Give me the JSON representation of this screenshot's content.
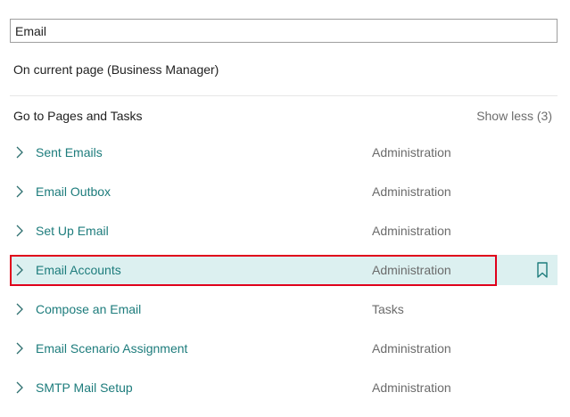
{
  "search": {
    "value": "Email",
    "placeholder": ""
  },
  "current_page_label": "On current page (Business Manager)",
  "pages_section": {
    "title": "Go to Pages and Tasks",
    "show_less": "Show less (3)"
  },
  "results": [
    {
      "label": "Sent Emails",
      "category": "Administration"
    },
    {
      "label": "Email Outbox",
      "category": "Administration"
    },
    {
      "label": "Set Up Email",
      "category": "Administration"
    },
    {
      "label": "Email Accounts",
      "category": "Administration",
      "selected": true
    },
    {
      "label": "Compose an Email",
      "category": "Tasks"
    },
    {
      "label": "Email Scenario Assignment",
      "category": "Administration"
    },
    {
      "label": "SMTP Mail Setup",
      "category": "Administration"
    }
  ],
  "colors": {
    "link": "#1d7c7c",
    "selected_row": "#dcf0f0",
    "highlight_border": "#e0001b"
  }
}
